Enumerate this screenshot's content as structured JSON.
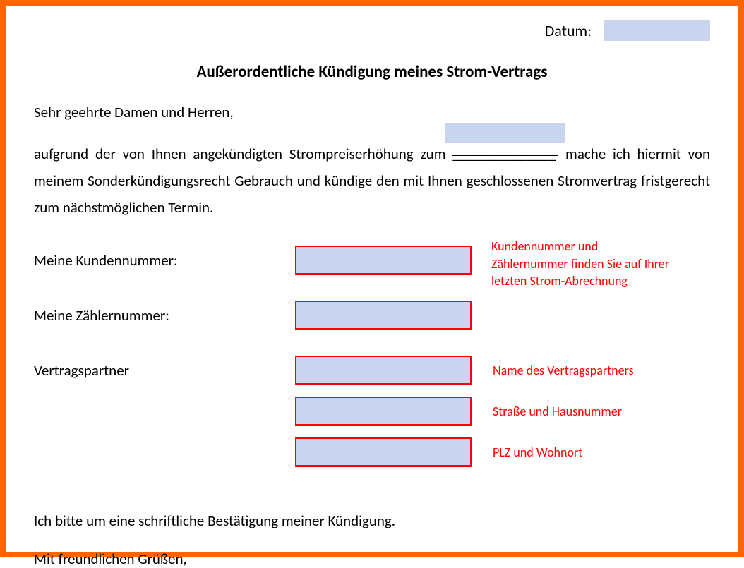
{
  "date": {
    "label": "Datum:"
  },
  "title": "Außerordentliche Kündigung meines Strom-Vertrags",
  "salutation": "Sehr geehrte Damen und Herren,",
  "body": {
    "part1": "aufgrund der von Ihnen angekündigten Strompreiserhöhung zum ",
    "blank": "______________",
    "part2": " mache ich hiermit von meinem Sonderkündigungsrecht Gebrauch und kündige den mit Ihnen geschlossenen Stromvertrag fristgerecht zum nächstmöglichen Termin."
  },
  "fields": {
    "kundennummer": {
      "label": "Meine Kundennummer:"
    },
    "zaehlernummer": {
      "label": "Meine Zählernummer:"
    },
    "vertragspartner": {
      "label": "Vertragspartner"
    }
  },
  "notes": {
    "kunden_zaehler": "Kundennummer und Zählernummer finden Sie auf Ihrer letzten Strom-Abrechnung",
    "name": "Name des Vertragspartners",
    "strasse": "Straße und Hausnummer",
    "plz": "PLZ und Wohnort"
  },
  "closing": {
    "line1": "Ich bitte um eine schriftliche Bestätigung meiner Kündigung.",
    "line2": "Mit freundlichen Grüßen,"
  }
}
